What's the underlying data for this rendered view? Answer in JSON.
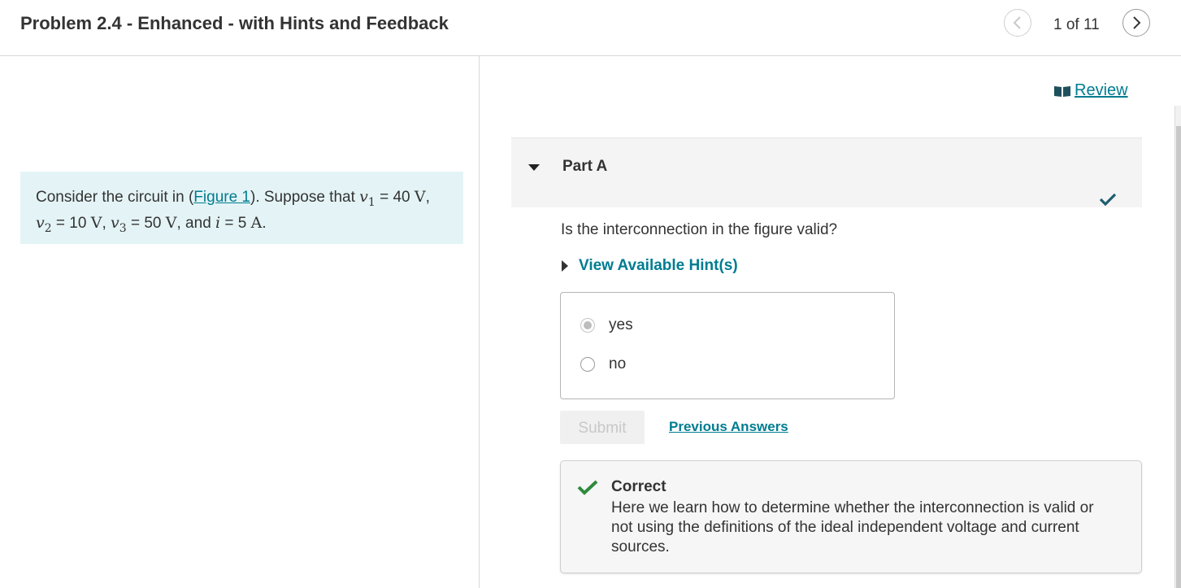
{
  "header": {
    "title": "Problem 2.4 - Enhanced - with Hints and Feedback",
    "page_counter": "1 of 11"
  },
  "intro": {
    "prefix": "Consider the circuit in (",
    "figure_link": "Figure 1",
    "middle": "). Suppose that ",
    "v1": {
      "symbol": "v",
      "sub": "1",
      "eq": " = 40 ",
      "unit": "V",
      "sep": ","
    },
    "v2": {
      "symbol": "v",
      "sub": "2",
      "eq": " = 10 ",
      "unit": "V",
      "sep": ", "
    },
    "v3": {
      "symbol": "v",
      "sub": "3",
      "eq": " = 50 ",
      "unit": "V",
      "sep": ", and "
    },
    "i": {
      "symbol": "i",
      "eq": " = 5 ",
      "unit": "A",
      "sep": "."
    }
  },
  "review": {
    "label": " Review"
  },
  "part": {
    "title": "Part A",
    "question": "Is the interconnection in the figure valid?",
    "hint_label": "View Available Hint(s)",
    "choices": [
      {
        "label": "yes",
        "selected": true
      },
      {
        "label": "no",
        "selected": false
      }
    ],
    "submit_label": "Submit",
    "previous_answers_label": "Previous Answers"
  },
  "feedback": {
    "title": "Correct",
    "text": "Here we learn how to determine whether the interconnection is valid or not using the definitions of the ideal independent voltage and current sources."
  },
  "colors": {
    "accent": "#007c91",
    "correct_green": "#2e8b3d",
    "check_dark": "#1e5e6e",
    "intro_bg": "#e4f4f6"
  }
}
